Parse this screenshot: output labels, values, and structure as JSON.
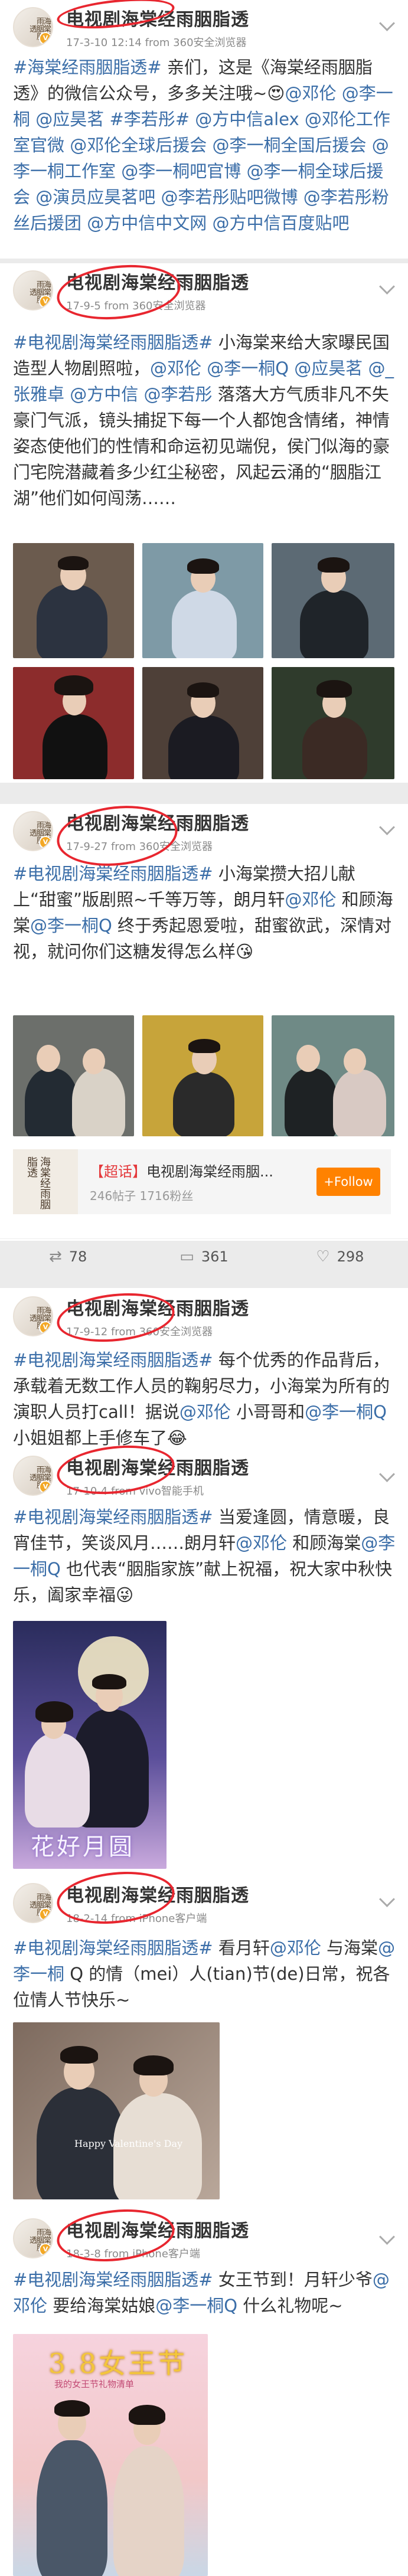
{
  "account": {
    "name": "电视剧海棠经雨胭脂透",
    "avatar_text": "海棠经雨胭脂透",
    "verified_badge": "V"
  },
  "posts": [
    {
      "meta": "17-3-10 12:14 from 360安全浏览器",
      "text": "#海棠经雨胭脂透# 亲们，这是《海棠经雨胭脂透》的微信公众号，多多关注哦~😍@邓伦 @李一桐 @应昊茗 #李若彤# @方中信alex @邓伦工作室官微 @邓伦全球后援会 @李一桐全国后援会 @李一桐工作室 @李一桐吧官博 @李一桐全球后援会 @演员应昊茗吧 @李若彤贴吧微博 @李若彤粉丝后援团 @方中信中文网 @方中信百度贴吧"
    },
    {
      "meta": "17-9-5 from 360安全浏览器",
      "text": "#电视剧海棠经雨胭脂透# 小海棠来给大家曝民国造型人物剧照啦，@邓伦 @李一桐Q @应昊茗 @_张雅卓 @方中信 @李若彤 落落大方气质非凡不失豪门气派，镜头捕捉下每一个人都饱含情绪，神情姿态使他们的性情和命运初见端倪，侯门似海的豪门宅院潜藏着多少红尘秘密，风起云涌的“胭脂江湖”他们如何闯荡……"
    },
    {
      "meta": "17-9-27 from 360安全浏览器",
      "text": "#电视剧海棠经雨胭脂透# 小海棠攒大招儿献上“甜蜜”版剧照~千等万等，朗月轩@邓伦 和顾海棠@李一桐Q 终于秀起恩爱啦，甜蜜欲武，深情对视，就问你们这糖发得怎么样😘",
      "topic": {
        "label": "【超话】",
        "title": "电视剧海棠经雨胭...",
        "stats": "246帖子 1716粉丝",
        "follow": "+Follow"
      },
      "actions": {
        "repost": "78",
        "comment": "361",
        "like": "298"
      }
    },
    {
      "meta": "17-9-12 from 360安全浏览器",
      "text": "#电视剧海棠经雨胭脂透# 每个优秀的作品背后，承载着无数工作人员的鞠躬尽力，小海棠为所有的演职人员打call！据说@邓伦 小哥哥和@李一桐Q 小姐姐都上手修车了😂"
    },
    {
      "meta": "17-10-4 from vivo智能手机",
      "text": "#电视剧海棠经雨胭脂透# 当爱逢圆，情意暖，良宵佳节，笑谈风月……朗月轩@邓伦 和顾海棠@李一桐Q 也代表“胭脂家族”献上祝福，祝大家中秋快乐，阖家幸福😜",
      "poster_title": "花好月圆"
    },
    {
      "meta": "18-2-14 from iPhone客户端",
      "text": "#电视剧海棠经雨胭脂透# 看月轩@邓伦 与海棠@李一桐 Q 的情（mei）人(tian)节(de)日常，祝各位情人节快乐~",
      "photo_caption": "Happy Valentine's Day"
    },
    {
      "meta": "18-3-8 from iPhone客户端",
      "text": "#电视剧海棠经雨胭脂透# 女王节到！月轩少爷@邓伦 要给海棠姑娘@李一桐Q 什么礼物呢~",
      "poster_title": "3.8女王节",
      "poster_sub": "我的女王节礼物清单"
    }
  ],
  "colors": {
    "link": "#3b6ea8",
    "circle": "#e8262f",
    "follow": "#ff8200"
  }
}
